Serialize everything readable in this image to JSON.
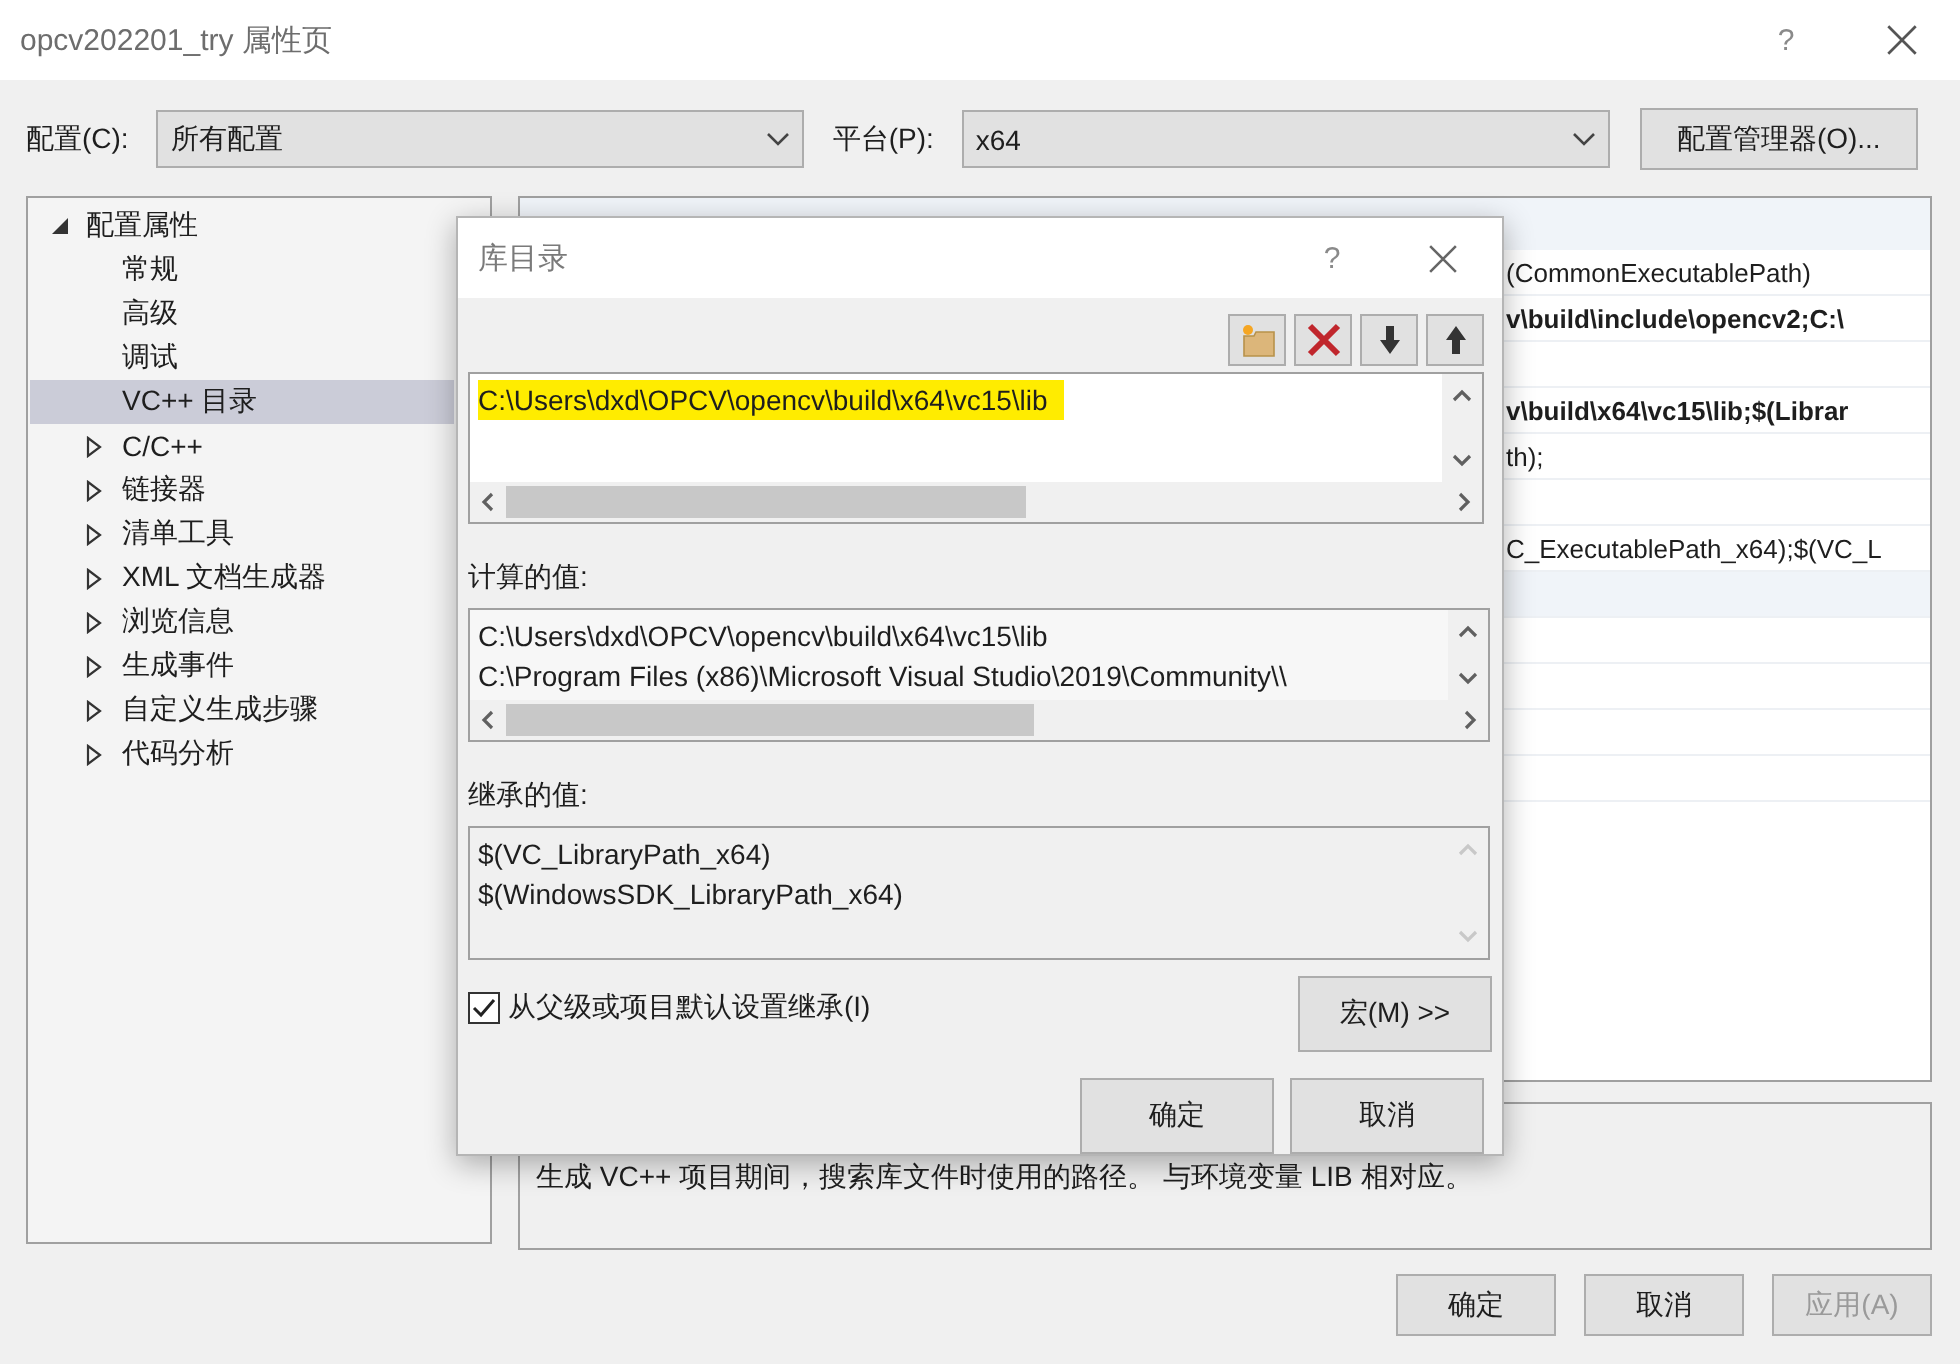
{
  "window": {
    "title": "opcv202201_try 属性页",
    "help": "?"
  },
  "config_bar": {
    "config_label": "配置(C):",
    "config_value": "所有配置",
    "platform_label": "平台(P):",
    "platform_value": "x64",
    "manager_button": "配置管理器(O)..."
  },
  "tree": [
    {
      "label": "配置属性",
      "kind": "group",
      "expanded": true,
      "selected": false,
      "children": [
        {
          "label": "常规",
          "kind": "leaf",
          "selected": false
        },
        {
          "label": "高级",
          "kind": "leaf",
          "selected": false
        },
        {
          "label": "调试",
          "kind": "leaf",
          "selected": false
        },
        {
          "label": "VC++ 目录",
          "kind": "leaf",
          "selected": true
        },
        {
          "label": "C/C++",
          "kind": "group",
          "expanded": false,
          "selected": false
        },
        {
          "label": "链接器",
          "kind": "group",
          "expanded": false,
          "selected": false
        },
        {
          "label": "清单工具",
          "kind": "group",
          "expanded": false,
          "selected": false
        },
        {
          "label": "XML 文档生成器",
          "kind": "group",
          "expanded": false,
          "selected": false
        },
        {
          "label": "浏览信息",
          "kind": "group",
          "expanded": false,
          "selected": false
        },
        {
          "label": "生成事件",
          "kind": "group",
          "expanded": false,
          "selected": false
        },
        {
          "label": "自定义生成步骤",
          "kind": "group",
          "expanded": false,
          "selected": false
        },
        {
          "label": "代码分析",
          "kind": "group",
          "expanded": false,
          "selected": false
        }
      ]
    }
  ],
  "grid": {
    "rows": [
      {
        "kind": "row",
        "value": "(CommonExecutablePath)",
        "bold": false
      },
      {
        "kind": "row",
        "value": "v\\build\\include\\opencv2;C:\\",
        "bold": true
      },
      {
        "kind": "empty"
      },
      {
        "kind": "row",
        "value": "v\\build\\x64\\vc15\\lib;$(Librar",
        "bold": true
      },
      {
        "kind": "row",
        "value": "th);",
        "bold": false
      },
      {
        "kind": "empty"
      },
      {
        "kind": "row",
        "value": "C_ExecutablePath_x64);$(VC_L",
        "bold": false
      },
      {
        "kind": "section"
      },
      {
        "kind": "empty"
      },
      {
        "kind": "empty"
      },
      {
        "kind": "empty"
      },
      {
        "kind": "empty"
      }
    ]
  },
  "description": "生成 VC++ 项目期间，搜索库文件时使用的路径。 与环境变量 LIB 相对应。",
  "buttons": [
    {
      "label": "确定",
      "disabled": false
    },
    {
      "label": "取消",
      "disabled": false
    },
    {
      "label": "应用(A)",
      "disabled": true
    }
  ],
  "dialog": {
    "title": "库目录",
    "help": "?",
    "entries": [
      {
        "text": "C:\\Users\\dxd\\OPCV\\opencv\\build\\x64\\vc15\\lib",
        "highlighted": true
      }
    ],
    "computed_label": "计算的值:",
    "computed": [
      "C:\\Users\\dxd\\OPCV\\opencv\\build\\x64\\vc15\\lib",
      "C:\\Program Files (x86)\\Microsoft Visual Studio\\2019\\Community\\\\"
    ],
    "inherited_label": "继承的值:",
    "inherited": [
      "$(VC_LibraryPath_x64)",
      "$(WindowsSDK_LibraryPath_x64)"
    ],
    "inherit_checkbox": {
      "label": "从父级或项目默认设置继承(I)",
      "checked": true
    },
    "macro_button": "宏(M) >>",
    "buttons": [
      "确定",
      "取消"
    ]
  }
}
